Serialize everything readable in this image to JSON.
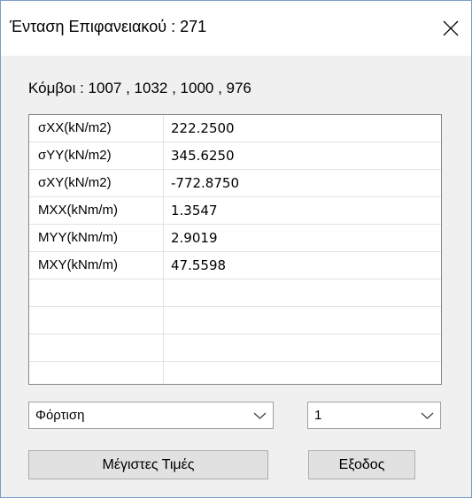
{
  "window": {
    "title": "Ένταση Επιφανειακού : 271"
  },
  "nodes_label": "Κόμβοι : 1007 , 1032 , 1000 , 976",
  "table": {
    "rows": [
      {
        "name": "σXX(kN/m2)",
        "value": "222.2500"
      },
      {
        "name": "σYY(kN/m2)",
        "value": "345.6250"
      },
      {
        "name": "σXY(kN/m2)",
        "value": "-772.8750"
      },
      {
        "name": "MXX(kNm/m)",
        "value": "1.3547"
      },
      {
        "name": "MYY(kNm/m)",
        "value": "2.9019"
      },
      {
        "name": "MXY(kNm/m)",
        "value": "47.5598"
      },
      {
        "name": "",
        "value": ""
      },
      {
        "name": "",
        "value": ""
      },
      {
        "name": "",
        "value": ""
      }
    ]
  },
  "load_select": {
    "value": "Φόρτιση",
    "icon": "chevron-down-icon"
  },
  "case_select": {
    "value": "1",
    "icon": "chevron-down-icon"
  },
  "buttons": {
    "max_values": "Μέγιστες Τιμές",
    "exit": "Εξοδος"
  },
  "icons": {
    "close": "close-icon"
  }
}
